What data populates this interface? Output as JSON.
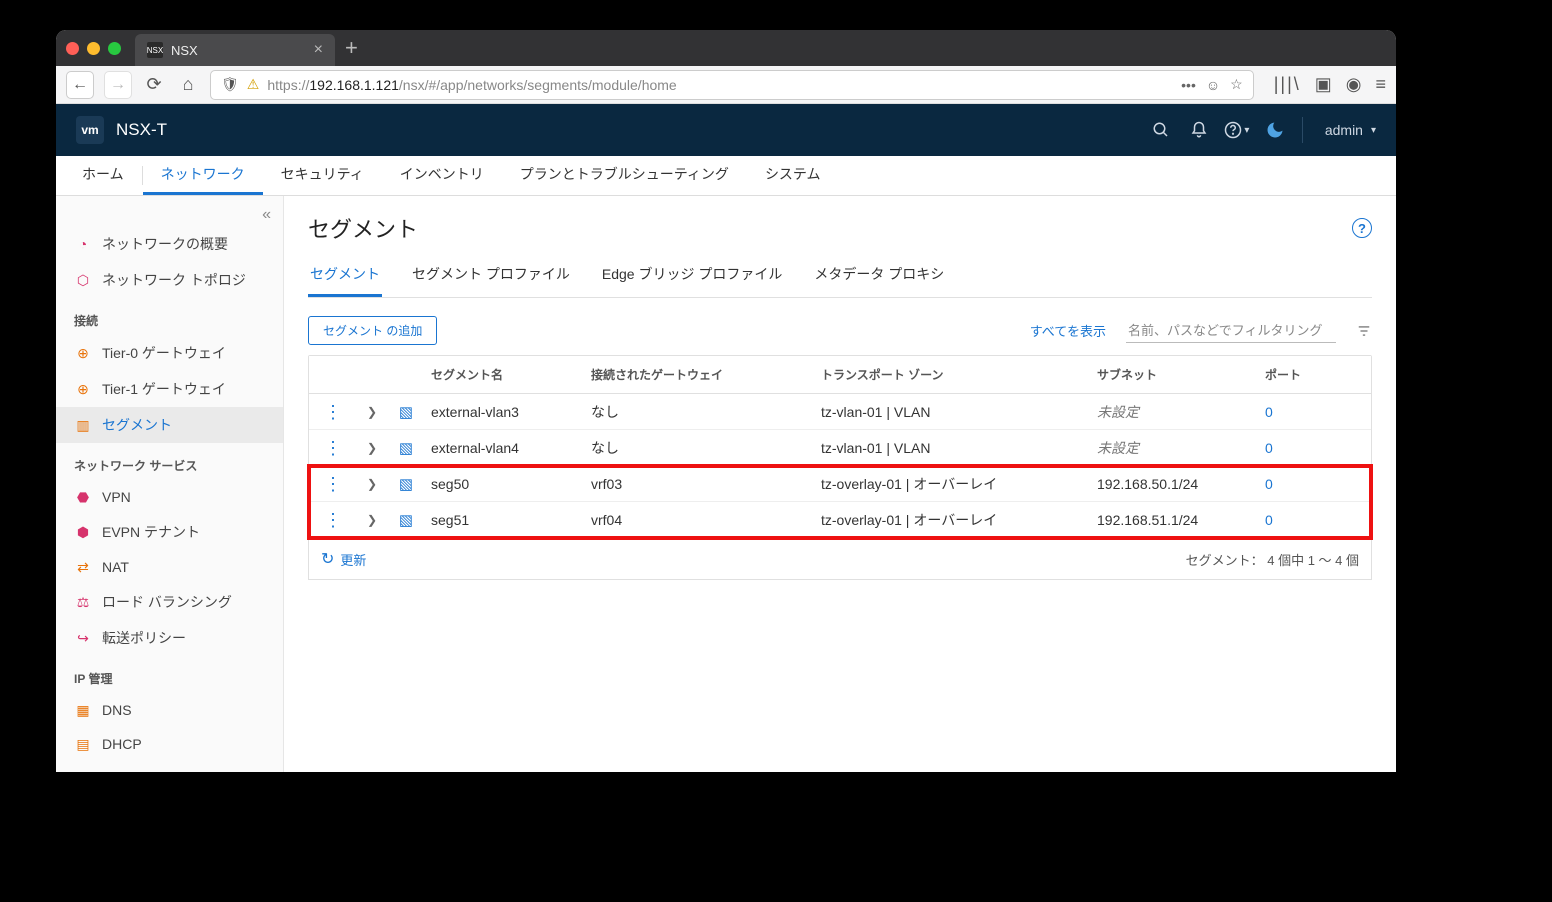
{
  "browser": {
    "tab_title": "NSX",
    "url_prefix": "https://",
    "url_bold": "192.168.1.121",
    "url_suffix": "/nsx/#/app/networks/segments/module/home"
  },
  "header": {
    "product": "NSX-T",
    "user": "admin"
  },
  "top_tabs": [
    "ホーム",
    "ネットワーク",
    "セキュリティ",
    "インベントリ",
    "プランとトラブルシューティング",
    "システム"
  ],
  "top_tabs_active_index": 1,
  "sidebar": {
    "groups": [
      {
        "heading": null,
        "items": [
          {
            "icon": "gauge",
            "label": "ネットワークの概要"
          },
          {
            "icon": "topology",
            "label": "ネットワーク トポロジ"
          }
        ]
      },
      {
        "heading": "接続",
        "items": [
          {
            "icon": "router",
            "label": "Tier-0 ゲートウェイ"
          },
          {
            "icon": "router",
            "label": "Tier-1 ゲートウェイ"
          },
          {
            "icon": "segment",
            "label": "セグメント",
            "active": true
          }
        ]
      },
      {
        "heading": "ネットワーク サービス",
        "items": [
          {
            "icon": "vpn",
            "label": "VPN"
          },
          {
            "icon": "evpn",
            "label": "EVPN テナント"
          },
          {
            "icon": "nat",
            "label": "NAT"
          },
          {
            "icon": "lb",
            "label": "ロード バランシング"
          },
          {
            "icon": "fwd",
            "label": "転送ポリシー"
          }
        ]
      },
      {
        "heading": "IP 管理",
        "items": [
          {
            "icon": "dns",
            "label": "DNS"
          },
          {
            "icon": "dhcp",
            "label": "DHCP"
          }
        ]
      }
    ]
  },
  "page": {
    "title": "セグメント",
    "subtabs": [
      "セグメント",
      "セグメント プロファイル",
      "Edge ブリッジ プロファイル",
      "メタデータ プロキシ"
    ],
    "subtabs_active_index": 0,
    "add_button": "セグメント の追加",
    "expand_all": "すべてを表示",
    "filter_placeholder": "名前、パスなどでフィルタリング",
    "refresh_label": "更新",
    "footer_count": "セグメント： 4 個中 1 ～ 4 個"
  },
  "table": {
    "columns": [
      "セグメント名",
      "接続されたゲートウェイ",
      "トランスポート ゾーン",
      "サブネット",
      "ポート"
    ],
    "rows": [
      {
        "name": "external-vlan3",
        "gateway": "なし",
        "tz": "tz-vlan-01 | VLAN",
        "subnet": "未設定",
        "subnet_italic": true,
        "ports": "0"
      },
      {
        "name": "external-vlan4",
        "gateway": "なし",
        "tz": "tz-vlan-01 | VLAN",
        "subnet": "未設定",
        "subnet_italic": true,
        "ports": "0"
      },
      {
        "name": "seg50",
        "gateway": "vrf03",
        "tz": "tz-overlay-01 | オーバーレイ",
        "subnet": "192.168.50.1/24",
        "subnet_italic": false,
        "ports": "0"
      },
      {
        "name": "seg51",
        "gateway": "vrf04",
        "tz": "tz-overlay-01 | オーバーレイ",
        "subnet": "192.168.51.1/24",
        "subnet_italic": false,
        "ports": "0"
      }
    ],
    "highlight_rows": [
      2,
      3
    ]
  }
}
